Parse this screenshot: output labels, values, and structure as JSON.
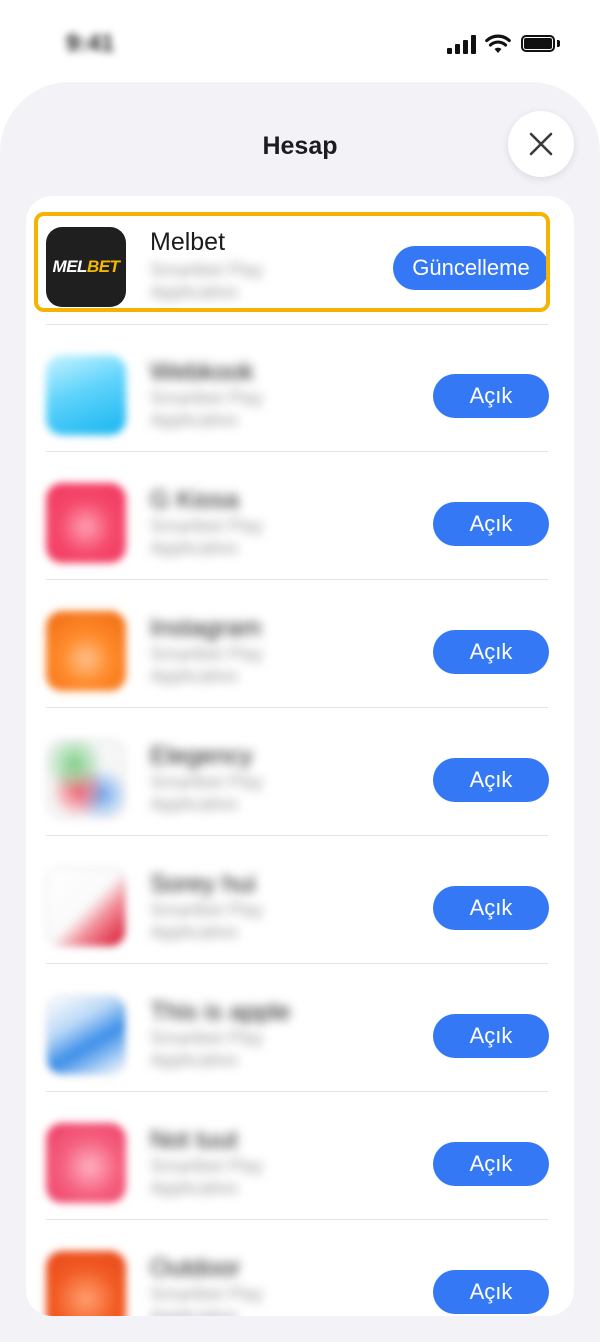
{
  "status_bar": {
    "time": "9:41"
  },
  "sheet": {
    "title": "Hesap"
  },
  "apps": [
    {
      "name": "Melbet",
      "sub1": "Smartbet Play",
      "sub2": "Application",
      "action": "Güncelleme",
      "logo_white": "MEL",
      "logo_yellow": "BET",
      "icon_colors": [
        "#1f1f1f",
        "#f5b800"
      ]
    },
    {
      "name": "Webkook",
      "sub1": "Smartbet Play",
      "sub2": "Application",
      "action": "Açık",
      "icon_colors": [
        "#8fe6ff",
        "#19b8f2"
      ]
    },
    {
      "name": "G Kiosa",
      "sub1": "Smartbet Play",
      "sub2": "Application",
      "action": "Açık",
      "icon_colors": [
        "#ff6b86",
        "#f23d62"
      ]
    },
    {
      "name": "Instagram",
      "sub1": "Smartbet Play",
      "sub2": "Application",
      "action": "Açık",
      "icon_colors": [
        "#ff9a2e",
        "#f06a12"
      ]
    },
    {
      "name": "Elegency",
      "sub1": "Smartbet Play",
      "sub2": "Application",
      "action": "Açık",
      "icon_colors": [
        "#67c77c",
        "#f05a6b"
      ]
    },
    {
      "name": "Sorey hui",
      "sub1": "Smartbet Play",
      "sub2": "Application",
      "action": "Açık",
      "icon_colors": [
        "#ffffff",
        "#d8102b"
      ]
    },
    {
      "name": "This is apple",
      "sub1": "Smartbet Play",
      "sub2": "Application",
      "action": "Açık",
      "icon_colors": [
        "#ffffff",
        "#2b86e8"
      ]
    },
    {
      "name": "Not tuut",
      "sub1": "Smartbet Play",
      "sub2": "Application",
      "action": "Açık",
      "icon_colors": [
        "#ff8fa6",
        "#ee3b63"
      ]
    },
    {
      "name": "Outdoor",
      "sub1": "Smartbet Play",
      "sub2": "Application",
      "action": "Açık",
      "icon_colors": [
        "#ff7a3d",
        "#ef4a1a"
      ]
    }
  ],
  "colors": {
    "accent": "#3478f6",
    "highlight": "#f5b300",
    "sheet_bg": "#f2f2f7"
  }
}
